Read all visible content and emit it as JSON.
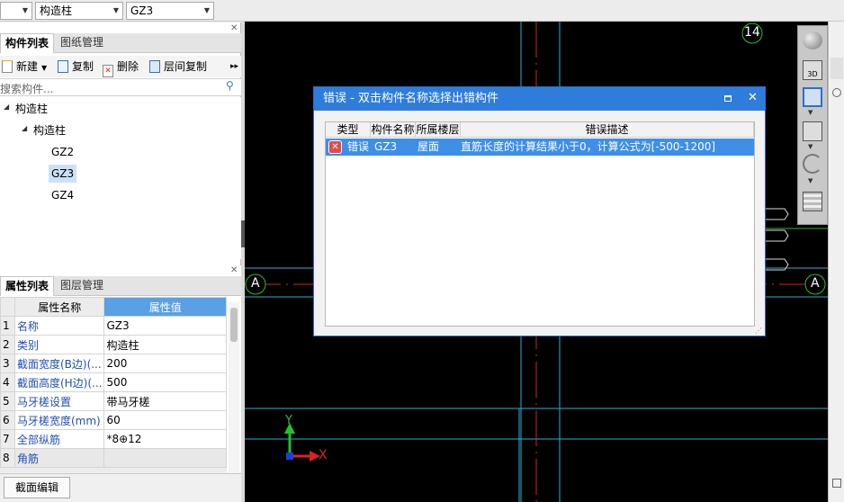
{
  "toolbar": {
    "combo_blank_value": "",
    "combo_type_value": "构造柱",
    "combo_name_value": "GZ3"
  },
  "component_panel": {
    "tabs": [
      "构件列表",
      "图纸管理"
    ],
    "buttons": {
      "new": "新建",
      "copy": "复制",
      "delete": "删除",
      "floor_copy": "层间复制"
    },
    "more_glyph": "▸▸",
    "search_placeholder": "搜索构件...",
    "tree": {
      "root": "构造柱",
      "group": "构造柱",
      "items": [
        "GZ2",
        "GZ3",
        "GZ4"
      ],
      "selected": "GZ3"
    }
  },
  "property_panel": {
    "tabs": [
      "属性列表",
      "图层管理"
    ],
    "headers": {
      "name": "属性名称",
      "value": "属性值"
    },
    "rows": [
      {
        "num": "1",
        "name": "名称",
        "value": "GZ3"
      },
      {
        "num": "2",
        "name": "类别",
        "value": "构造柱"
      },
      {
        "num": "3",
        "name": "截面宽度(B边)(...",
        "value": "200"
      },
      {
        "num": "4",
        "name": "截面高度(H边)(...",
        "value": "500"
      },
      {
        "num": "5",
        "name": "马牙槎设置",
        "value": "带马牙槎"
      },
      {
        "num": "6",
        "name": "马牙槎宽度(mm)",
        "value": "60"
      },
      {
        "num": "7",
        "name": "全部纵筋",
        "value": "*8⊕12"
      },
      {
        "num": "8",
        "name": "角筋",
        "value": ""
      }
    ],
    "bottom_button": "截面编辑"
  },
  "canvas": {
    "axis_label_top": "14",
    "axis_label_left": "A",
    "axis_label_right": "A",
    "ucs_x": "X",
    "ucs_y": "Y"
  },
  "right_tools": {
    "view3d_label": "3D"
  },
  "dialog": {
    "title": "错误 - 双击构件名称选择出错构件",
    "columns": [
      "类型",
      "构件名称",
      "所属楼层",
      "错误描述"
    ],
    "rows": [
      {
        "type": "错误",
        "component": "GZ3",
        "floor": "屋面",
        "description": "直筋长度的计算结果小于0，计算公式为[-500-1200]"
      }
    ]
  },
  "colors": {
    "dialog_title_bg": "#2e7ddb",
    "selected_row_bg": "#3d8fe8",
    "canvas_bg": "#000000",
    "axis_cyan": "#1fb6d6",
    "axis_red": "#e0201f",
    "axis_green": "#22c22a"
  }
}
